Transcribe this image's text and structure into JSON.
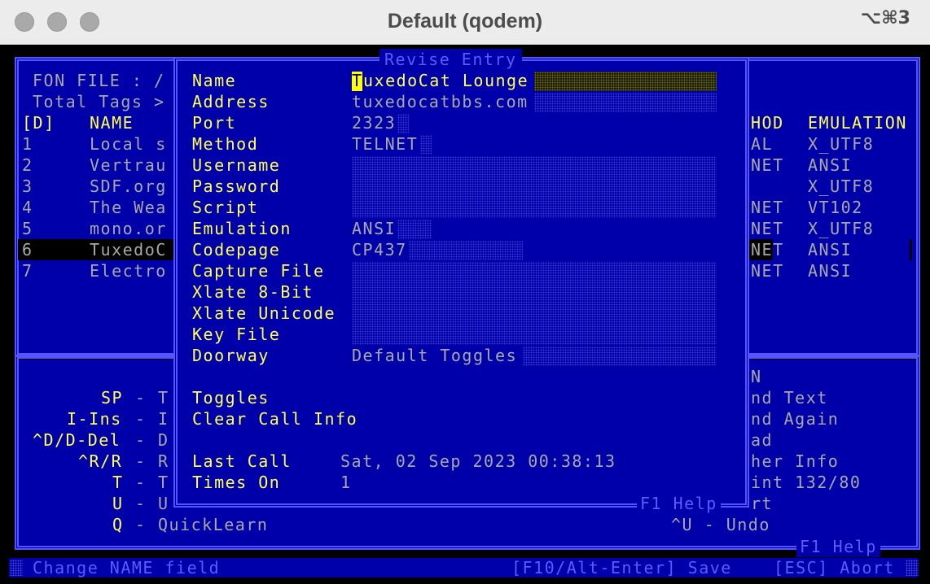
{
  "window": {
    "title": "Default (qodem)",
    "shortcut": "⌥⌘3"
  },
  "phonebook": {
    "fon_file": "FON FILE : /",
    "total_tags": "Total Tags >",
    "col_d": "[D]",
    "col_name": "NAME",
    "col_method": "HOD",
    "col_emulation": "EMULATION",
    "rows": [
      {
        "num": "1",
        "name": "Local s",
        "method": "AL",
        "emulation": "X_UTF8"
      },
      {
        "num": "2",
        "name": "Vertrau",
        "method": "NET",
        "emulation": "ANSI"
      },
      {
        "num": "3",
        "name": "SDF.org",
        "method": "",
        "emulation": "X_UTF8"
      },
      {
        "num": "4",
        "name": "The Wea",
        "method": "NET",
        "emulation": "VT102"
      },
      {
        "num": "5",
        "name": "mono.or",
        "method": "NET",
        "emulation": "X_UTF8"
      },
      {
        "num": "6",
        "name": "TuxedoC",
        "method": "NET",
        "emulation": "ANSI"
      },
      {
        "num": "7",
        "name": "Electro",
        "method": "NET",
        "emulation": "ANSI"
      }
    ]
  },
  "keys": {
    "left": [
      {
        "key": "SP",
        "sep": "-",
        "desc": "T"
      },
      {
        "key": "I-Ins",
        "sep": "-",
        "desc": "I"
      },
      {
        "key": "^D/D-Del",
        "sep": "-",
        "desc": "D"
      },
      {
        "key": "^R/R",
        "sep": "-",
        "desc": "R"
      },
      {
        "key": "T",
        "sep": "-",
        "desc": "T"
      },
      {
        "key": "U",
        "sep": "-",
        "desc": "U"
      },
      {
        "key": "Q",
        "sep": "-",
        "desc": "QuickLearn"
      }
    ],
    "right": [
      "N",
      "nd Text",
      "nd Again",
      "ad",
      "her Info",
      "int 132/80",
      "rt"
    ],
    "undo": "^U - Undo",
    "help": "F1 Help"
  },
  "dialog": {
    "title": "Revise Entry",
    "help": "F1 Help",
    "fields": [
      {
        "label": "Name",
        "value": "TuxedoCat Lounge",
        "cursor": "T",
        "rest": "uxedoCat Lounge"
      },
      {
        "label": "Address",
        "value": "tuxedocatbbs.com"
      },
      {
        "label": "Port",
        "value": "2323"
      },
      {
        "label": "Method",
        "value": "TELNET"
      },
      {
        "label": "Username",
        "value": ""
      },
      {
        "label": "Password",
        "value": ""
      },
      {
        "label": "Script",
        "value": ""
      },
      {
        "label": "Emulation",
        "value": "ANSI"
      },
      {
        "label": "Codepage",
        "value": "CP437"
      },
      {
        "label": "Capture File",
        "value": ""
      },
      {
        "label": "Xlate 8-Bit",
        "value": ""
      },
      {
        "label": "Xlate Unicode",
        "value": ""
      },
      {
        "label": "Key File",
        "value": ""
      },
      {
        "label": "Doorway",
        "value": "Default Toggles"
      }
    ],
    "toggles": "Toggles",
    "clear_call_info": "Clear Call Info",
    "last_call_label": "Last Call",
    "last_call_value": "Sat, 02 Sep 2023 00:38:13",
    "times_on_label": "Times On",
    "times_on_value": "1"
  },
  "status": {
    "hint": "Change NAME field",
    "save": "[F10/Alt-Enter] Save",
    "abort": "[ESC] Abort"
  },
  "colors": {
    "panel_blue": "#0000aa",
    "frame": "#5555ff",
    "label_yellow": "#ffff55",
    "value_gray": "#a8a8a8"
  }
}
